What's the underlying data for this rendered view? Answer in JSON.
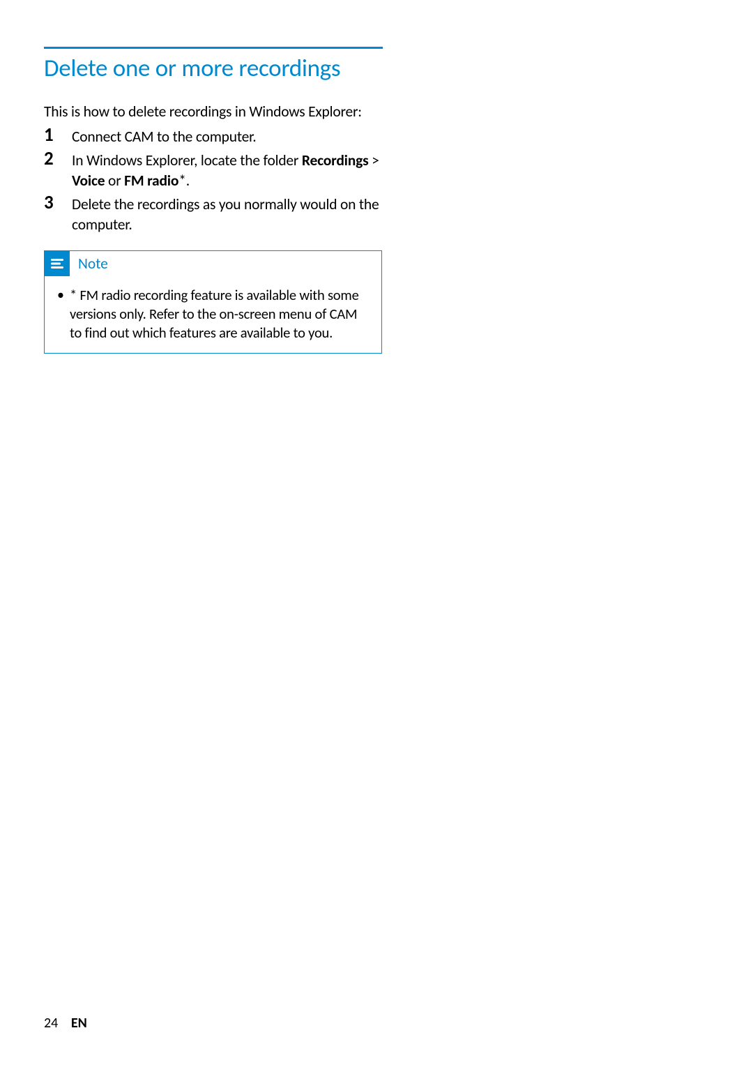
{
  "section": {
    "heading": "Delete one or more recordings",
    "intro": "This is how to delete recordings in Windows Explorer:",
    "steps": [
      {
        "num": "1",
        "parts": [
          {
            "t": "Connect CAM to the computer.",
            "b": false
          }
        ]
      },
      {
        "num": "2",
        "parts": [
          {
            "t": "In Windows Explorer, locate the folder ",
            "b": false
          },
          {
            "t": "Recordings",
            "b": true
          },
          {
            "t": " > ",
            "b": false
          },
          {
            "t": "Voice",
            "b": true
          },
          {
            "t": " or ",
            "b": false
          },
          {
            "t": "FM radio",
            "b": true
          },
          {
            "t": "*.",
            "b": false
          }
        ]
      },
      {
        "num": "3",
        "parts": [
          {
            "t": "Delete the recordings as you normally would on the computer.",
            "b": false
          }
        ]
      }
    ]
  },
  "note": {
    "label": "Note",
    "icon": "note-icon",
    "bullets": [
      "* FM radio recording feature is available with some versions only. Refer to the on-screen menu of CAM to find out which features are available to you."
    ]
  },
  "footer": {
    "page_number": "24",
    "language": "EN"
  }
}
